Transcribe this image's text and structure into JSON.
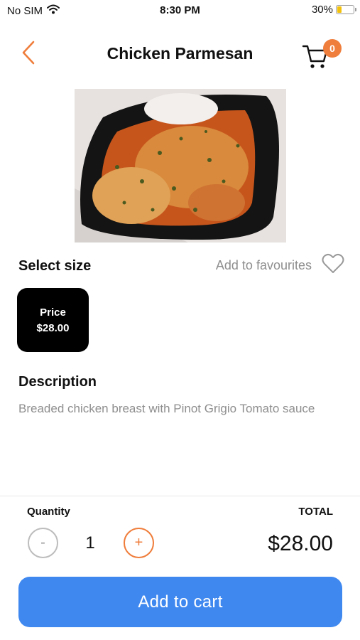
{
  "status_bar": {
    "carrier": "No SIM",
    "time": "8:30 PM",
    "battery_percent": "30%",
    "battery_level": 0.3,
    "battery_color": "#f2c10d",
    "wifi_icon": "wifi-icon"
  },
  "nav": {
    "title": "Chicken Parmesan",
    "back_icon": "chevron-left-icon",
    "cart_icon": "shopping-cart-icon",
    "cart_count": "0",
    "accent_color": "#ef7d3b"
  },
  "product": {
    "image_alt": "Chicken Parmesan"
  },
  "size_section": {
    "title": "Select size",
    "favourites_label": "Add to favourites",
    "favourites_icon": "heart-outline-icon",
    "options": [
      {
        "label": "Price",
        "price": "$28.00",
        "selected": true
      }
    ]
  },
  "description": {
    "title": "Description",
    "text": "Breaded chicken breast with Pinot Grigio Tomato sauce"
  },
  "order": {
    "quantity_label": "Quantity",
    "quantity": "1",
    "minus_label": "-",
    "plus_label": "+",
    "total_label": "TOTAL",
    "total": "$28.00"
  },
  "add_to_cart": {
    "label": "Add to cart",
    "color": "#3f88f0"
  }
}
